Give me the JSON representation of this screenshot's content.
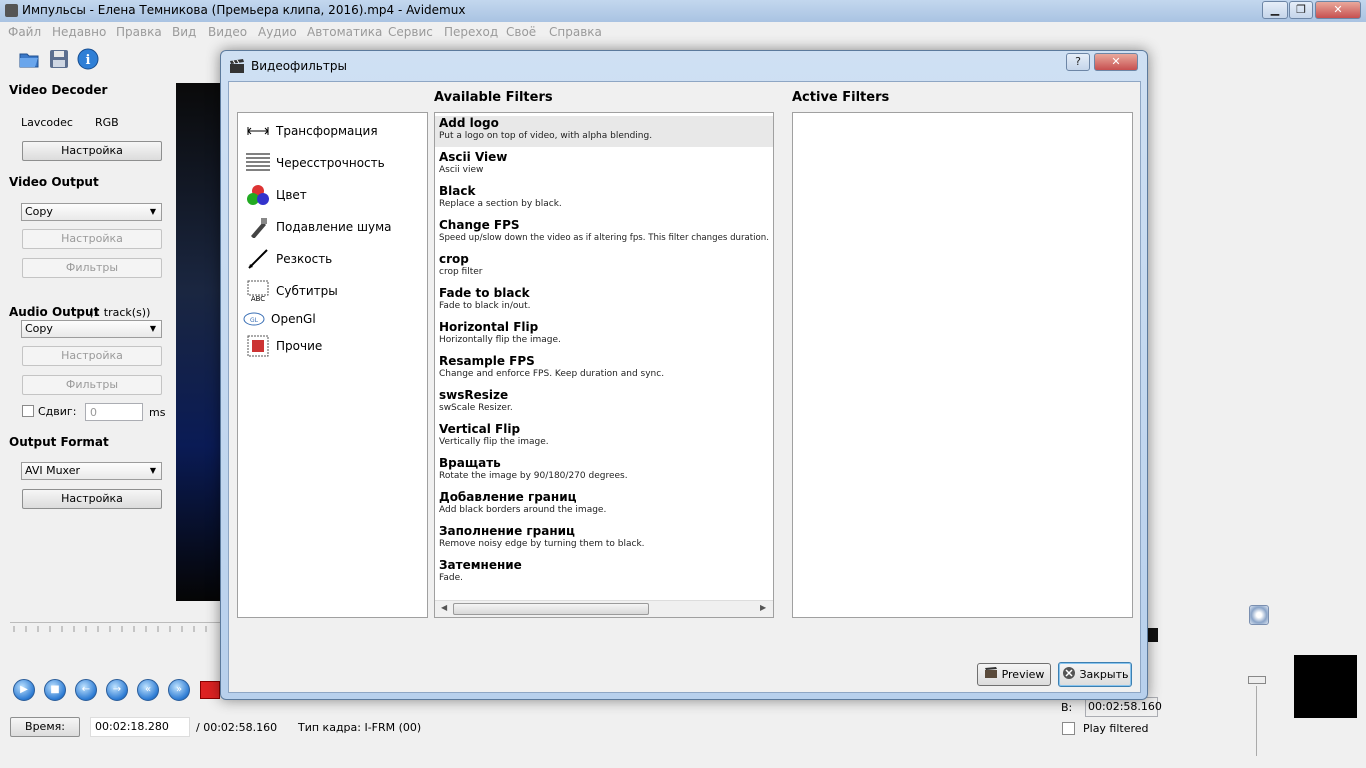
{
  "window": {
    "title": "Импульсы - Елена Темникова (Премьера клипа, 2016).mp4 - Avidemux",
    "minimize": "▁",
    "maximize": "❐",
    "close": "✕"
  },
  "menu": [
    "Файл",
    "Недавно",
    "Правка",
    "Вид",
    "Видео",
    "Аудио",
    "Автоматика",
    "Сервис",
    "Переход",
    "Своё",
    "Справка"
  ],
  "left": {
    "video_decoder": {
      "title": "Video Decoder",
      "codec": "Lavcodec",
      "format": "RGB",
      "settings": "Настройка"
    },
    "video_output": {
      "title": "Video Output",
      "codec": "Copy",
      "settings": "Настройка",
      "filters": "Фильтры"
    },
    "audio_output": {
      "title": "Audio Output",
      "tracks": "(1 track(s))",
      "codec": "Copy",
      "settings": "Настройка",
      "filters": "Фильтры",
      "shift_label": "Сдвиг:",
      "shift_value": "0",
      "unit": "ms"
    },
    "output_format": {
      "title": "Output Format",
      "muxer": "AVI Muxer",
      "settings": "Настройка"
    }
  },
  "status": {
    "time_button": "Время:",
    "current_time": "00:02:18.280",
    "total_time": "/ 00:02:58.160",
    "frame_type": "Тип кадра:  I-FRM (00)",
    "b_label": "B:",
    "b_time": "00:02:58.160",
    "play_filtered": "Play filtered"
  },
  "dialog": {
    "title": "Видеофильтры",
    "help": "?",
    "close_x": "✕",
    "available_header": "Available Filters",
    "active_header": "Active Filters",
    "categories": [
      {
        "label": "Трансформация",
        "icon": "resize-icon"
      },
      {
        "label": "Чересстрочность",
        "icon": "interlace-icon"
      },
      {
        "label": "Цвет",
        "icon": "color-balls-icon"
      },
      {
        "label": "Подавление шума",
        "icon": "noise-icon"
      },
      {
        "label": "Резкость",
        "icon": "sharpen-icon"
      },
      {
        "label": "Субтитры",
        "icon": "subtitles-icon"
      },
      {
        "label": "OpenGl",
        "icon": "opengl-icon"
      },
      {
        "label": "Прочие",
        "icon": "misc-icon"
      }
    ],
    "filters": [
      {
        "name": "Add logo",
        "desc": "Put a logo on top of video, with alpha blending."
      },
      {
        "name": "Ascii View",
        "desc": "Ascii view"
      },
      {
        "name": "Black",
        "desc": "Replace a section by black."
      },
      {
        "name": "Change FPS",
        "desc": "Speed up/slow down the video as if altering fps. This filter changes duration."
      },
      {
        "name": "crop",
        "desc": "crop filter"
      },
      {
        "name": "Fade to black",
        "desc": "Fade to black in/out."
      },
      {
        "name": "Horizontal Flip",
        "desc": "Horizontally flip the image."
      },
      {
        "name": "Resample FPS",
        "desc": "Change and enforce FPS. Keep duration and sync."
      },
      {
        "name": "swsResize",
        "desc": "swScale Resizer."
      },
      {
        "name": "Vertical Flip",
        "desc": "Vertically flip the image."
      },
      {
        "name": "Вращать",
        "desc": "Rotate the image by 90/180/270 degrees."
      },
      {
        "name": "Добавление границ",
        "desc": "Add black borders around the image."
      },
      {
        "name": "Заполнение границ",
        "desc": "Remove noisy edge by turning them to black."
      },
      {
        "name": "Затемнение",
        "desc": "Fade."
      }
    ],
    "preview": "Preview",
    "close": "Закрыть"
  }
}
